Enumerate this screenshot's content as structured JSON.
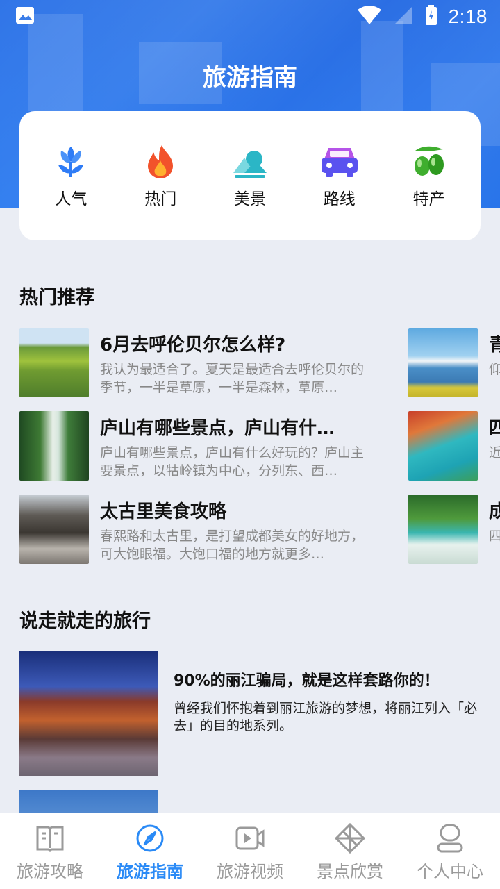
{
  "status_bar": {
    "time": "2:18"
  },
  "header": {
    "title": "旅游指南"
  },
  "categories": [
    {
      "label": "人气",
      "icon": "tulip-icon",
      "color": "#2f7cf6"
    },
    {
      "label": "热门",
      "icon": "flame-icon",
      "color": "#f2522b"
    },
    {
      "label": "美景",
      "icon": "landscape-icon",
      "color": "#2bb6c6"
    },
    {
      "label": "路线",
      "icon": "car-icon",
      "color": "#5a52ef"
    },
    {
      "label": "特产",
      "icon": "olive-icon",
      "color": "#3fae2e"
    }
  ],
  "hot_section": {
    "title": "热门推荐"
  },
  "hot_items": [
    {
      "title": "6月去呼伦贝尔怎么样?",
      "desc": "我认为最适合了。夏天是最适合去呼伦贝尔的季节，一半是草原，一半是森林，草原…"
    },
    {
      "title": "庐山有哪些景点，庐山有什…",
      "desc": "庐山有哪些景点，庐山有什么好玩的？庐山主要景点，以牯岭镇为中心，分列东、西…"
    },
    {
      "title": "太古里美食攻略",
      "desc": "春熙路和太古里，是打望成都美女的好地方，可大饱眼福。大饱口福的地方就更多…"
    }
  ],
  "hot_items_col2": [
    {
      "title": "青",
      "desc": "仰域"
    },
    {
      "title": "四",
      "desc": "近面"
    },
    {
      "title": "成",
      "desc": "四优"
    }
  ],
  "trip_section": {
    "title": "说走就走的旅行"
  },
  "trip_items": [
    {
      "title": "90%的丽江骗局，就是这样套路你的！",
      "desc": "曾经我们怀抱着到丽江旅游的梦想，将丽江列入「必去」的目的地系列。"
    },
    {
      "title": "",
      "desc": ""
    }
  ],
  "bottom_nav": [
    {
      "label": "旅游攻略",
      "icon": "book-icon",
      "active": false
    },
    {
      "label": "旅游指南",
      "icon": "compass-icon",
      "active": true
    },
    {
      "label": "旅游视频",
      "icon": "video-icon",
      "active": false
    },
    {
      "label": "景点欣赏",
      "icon": "diamond-icon",
      "active": false
    },
    {
      "label": "个人中心",
      "icon": "user-icon",
      "active": false
    }
  ],
  "colors": {
    "accent": "#2a8af6",
    "inactive": "#9a9a9a",
    "background": "#eaedf4"
  }
}
